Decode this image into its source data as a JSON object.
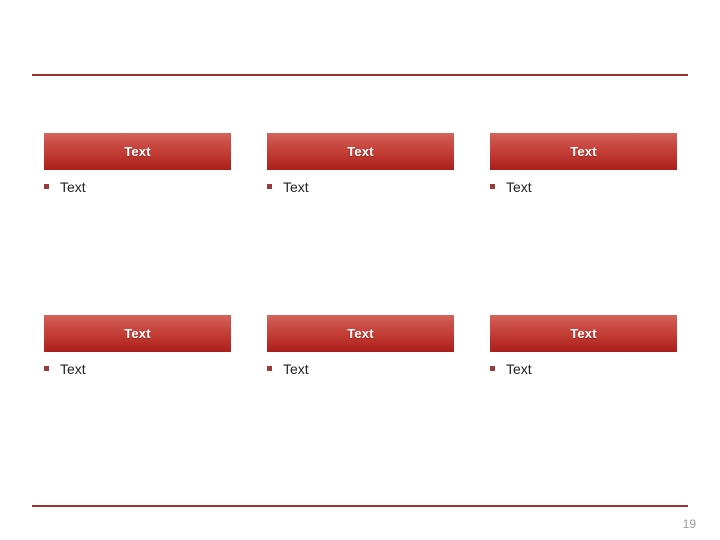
{
  "slide": {
    "page_number": "19",
    "accent_color": "#9e3232",
    "box_gradient_top": "#d4655c",
    "box_gradient_bottom": "#ab1f1a",
    "bullet_color": "#9b3a3a",
    "page_number_color": "#9a9a9a",
    "background_color": "#ffffff"
  },
  "rules": {
    "top_label": "top-divider",
    "bottom_label": "bottom-divider"
  },
  "blocks": [
    {
      "header": "Text",
      "bullet": "Text",
      "column": 1,
      "row": 1
    },
    {
      "header": "Text",
      "bullet": "Text",
      "column": 2,
      "row": 1
    },
    {
      "header": "Text",
      "bullet": "Text",
      "column": 3,
      "row": 1
    },
    {
      "header": "Text",
      "bullet": "Text",
      "column": 1,
      "row": 2
    },
    {
      "header": "Text",
      "bullet": "Text",
      "column": 2,
      "row": 2
    },
    {
      "header": "Text",
      "bullet": "Text",
      "column": 3,
      "row": 2
    }
  ]
}
